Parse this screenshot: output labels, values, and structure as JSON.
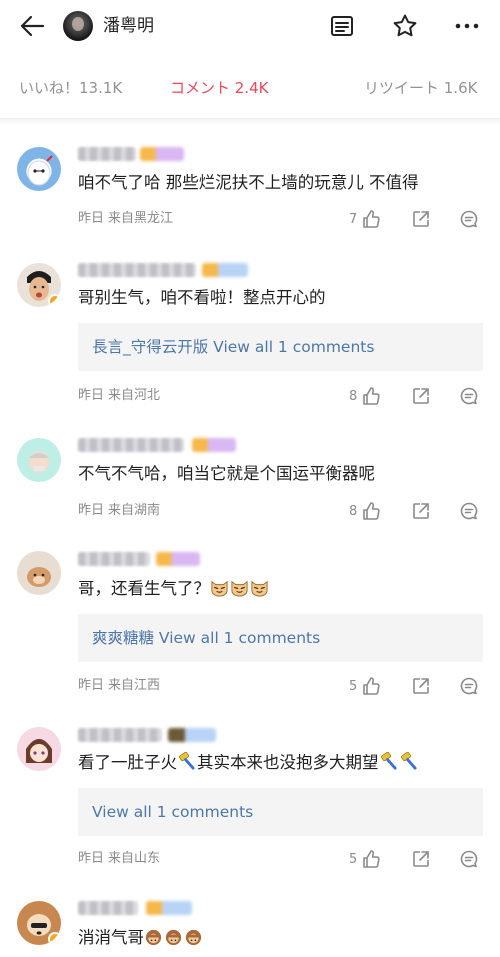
{
  "header": {
    "user_name": "潘粤明",
    "icons": [
      "back-arrow-icon",
      "document-icon",
      "star-icon",
      "more-icon"
    ]
  },
  "tabs": {
    "likes": "いいね！13.1K",
    "comments": "コメント 2.4K",
    "retweets": "リツイート 1.6K",
    "active": "comments"
  },
  "colors": {
    "accent": "#e8485a",
    "link": "#4d77a8",
    "meta": "#8a8a8a",
    "reply_bg": "#f4f4f4"
  },
  "comments": [
    {
      "text": "咱不气了哈 那些烂泥扶不上墙的玩意儿 不值得",
      "time": "昨日",
      "location": "来自黑龙江",
      "likes": "7",
      "reply": ""
    },
    {
      "text": "哥别生气，咱不看啦！整点开心的",
      "time": "昨日",
      "location": "来自河北",
      "likes": "8",
      "reply": "長言_守得云开版 View all 1 comments"
    },
    {
      "text": "不气不气哈，咱当它就是个国运平衡器呢",
      "time": "昨日",
      "location": "来自湖南",
      "likes": "8",
      "reply": ""
    },
    {
      "text": "哥，还看生气了？",
      "emojis": [
        "cat-face-icon",
        "cat-face-icon",
        "cat-face-icon"
      ],
      "time": "昨日",
      "location": "来自江西",
      "likes": "5",
      "reply": "爽爽糖糖 View all 1 comments"
    },
    {
      "text_a": "看了一肚子火",
      "text_b": "其实本来也没抱多大期望",
      "emojis": [
        "hammer-icon",
        "hammer-icon",
        "hammer-icon"
      ],
      "time": "昨日",
      "location": "来自山东",
      "likes": "5",
      "reply": "View all 1 comments"
    },
    {
      "text": "消消气哥",
      "emojis": [
        "monkey-face-icon",
        "monkey-face-icon",
        "monkey-face-icon"
      ]
    }
  ]
}
